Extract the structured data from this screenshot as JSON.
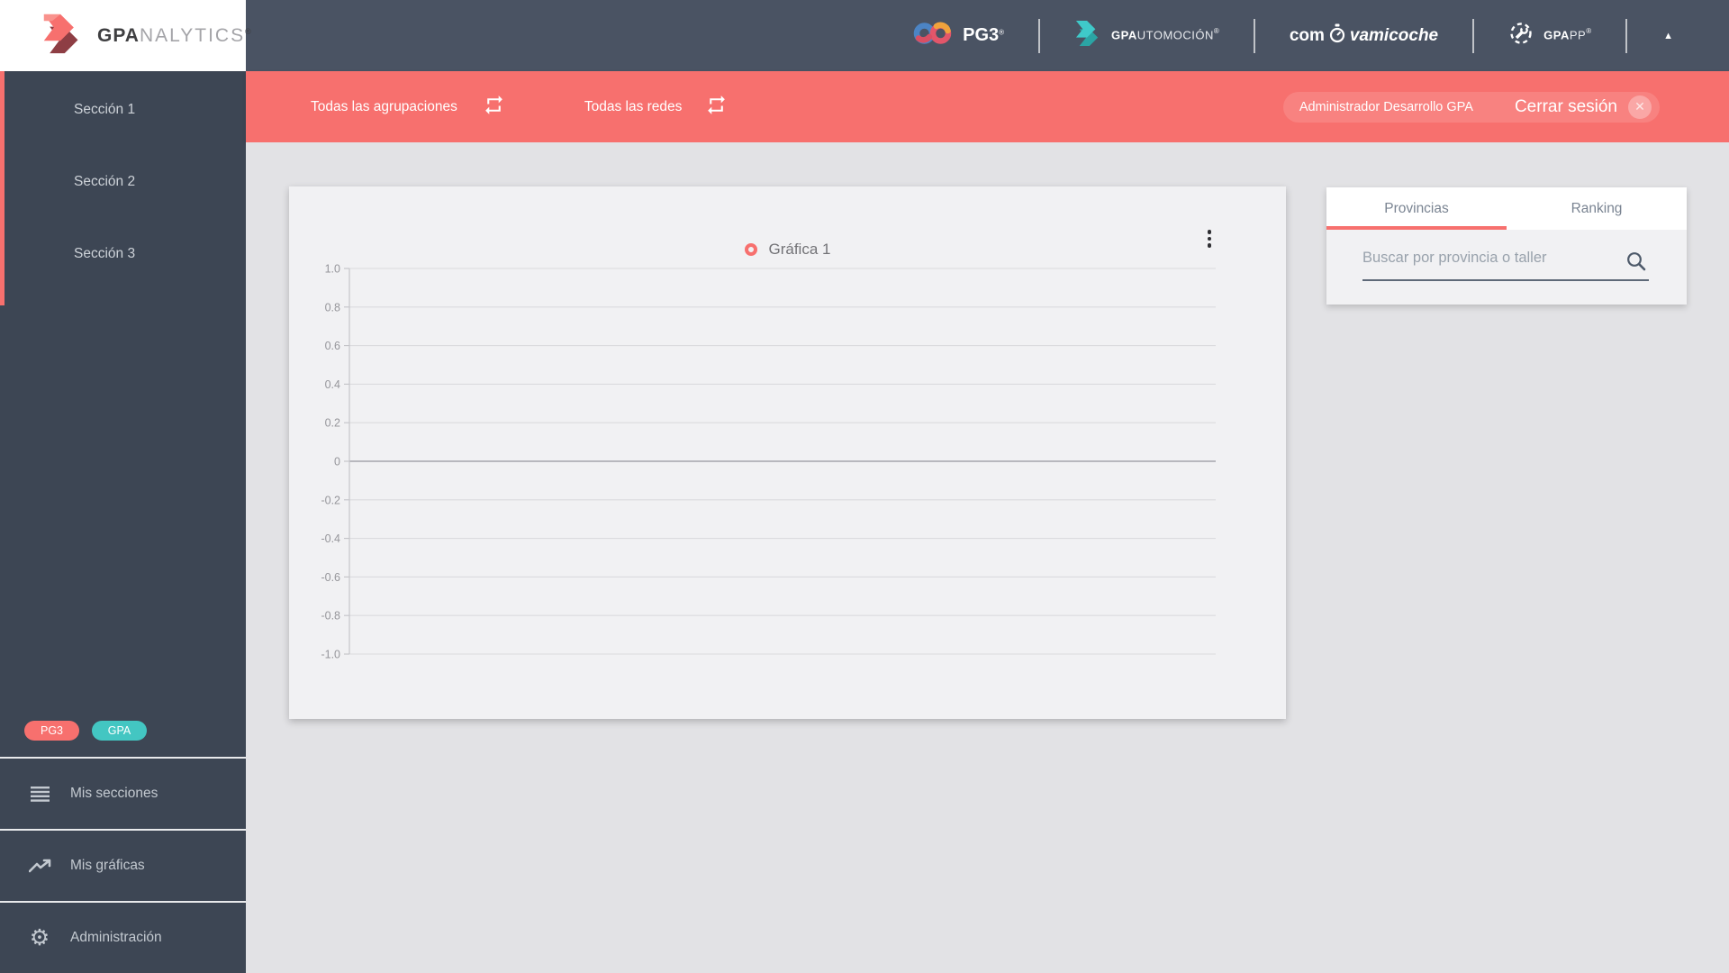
{
  "app": {
    "title_bold": "GPA",
    "title_light": "NALYTICS",
    "title_reg": "®"
  },
  "header": {
    "pg3": {
      "label": "PG3",
      "reg": "®"
    },
    "gpautomocion": {
      "bold": "GPA",
      "light": "UTOMOCIÓN",
      "reg": "®"
    },
    "comprovamicoche": {
      "pre": "com",
      "post": "vamicoche"
    },
    "gpapp": {
      "bold": "GPA",
      "light": "PP",
      "reg": "®"
    }
  },
  "filterbar": {
    "groupings_label": "Todas las agrupaciones",
    "networks_label": "Todas las redes",
    "user_label": "Administrador Desarrollo GPA",
    "logout_label": "Cerrar sesión",
    "logout_x": "✕"
  },
  "sidebar": {
    "sections": [
      {
        "label": "Sección 1"
      },
      {
        "label": "Sección 2"
      },
      {
        "label": "Sección 3"
      }
    ],
    "badges": [
      {
        "label": "PG3",
        "color": "#F7706E"
      },
      {
        "label": "GPA",
        "color": "#43C6C2"
      }
    ],
    "menu": [
      {
        "label": "Mis secciones",
        "icon": "list-icon"
      },
      {
        "label": "Mis gráficas",
        "icon": "chart-line-icon"
      },
      {
        "label": "Administración",
        "icon": "gear-icon"
      }
    ],
    "gear_glyph": "⚙"
  },
  "right_panel": {
    "tabs": [
      {
        "label": "Provincias",
        "active": true
      },
      {
        "label": "Ranking",
        "active": false
      }
    ],
    "search_placeholder": "Buscar por provincia o taller"
  },
  "chart_data": {
    "type": "line",
    "legend": [
      {
        "name": "Gráfica 1",
        "color": "#F7706E"
      }
    ],
    "series": [
      {
        "name": "Gráfica 1",
        "values": []
      }
    ],
    "x": [],
    "ylim": [
      -1.0,
      1.0
    ],
    "y_ticks": [
      "1.0",
      "0.8",
      "0.6",
      "0.4",
      "0.2",
      "0",
      "-0.2",
      "-0.4",
      "-0.6",
      "-0.8",
      "-1.0"
    ],
    "grid": true,
    "legend_position": "top-center"
  },
  "misc": {
    "collapse_glyph": "▲"
  },
  "colors": {
    "accent_red": "#F7706E",
    "teal": "#43C6C2",
    "header_bg": "#4A5363",
    "sidebar_bg": "#3D4654",
    "content_bg": "#E2E2E5",
    "card_bg": "#F1F1F3",
    "tab_bar_bg": "#FFFFFF"
  }
}
